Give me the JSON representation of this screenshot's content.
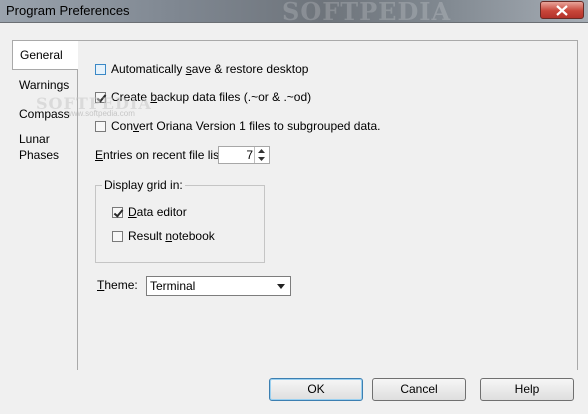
{
  "window": {
    "title": "Program Preferences",
    "watermark_title": "SOFTPEDIA",
    "close_icon": "close-x-icon"
  },
  "tabs": [
    {
      "label": "General",
      "active": true
    },
    {
      "label": "Warnings",
      "active": false
    },
    {
      "label": "Compass",
      "active": false
    },
    {
      "label": "Lunar Phases",
      "active": false
    }
  ],
  "general": {
    "auto_save": {
      "pre": "Automatically ",
      "ul": "s",
      "post": "ave & restore desktop",
      "checked": false
    },
    "backup": {
      "pre": "Create ",
      "ul": "b",
      "post": "ackup data files (.~or & .~od)",
      "checked": true
    },
    "convert": {
      "pre": "Con",
      "ul": "v",
      "post": "ert Oriana Version 1 files to subgrouped data.",
      "checked": false
    },
    "recent": {
      "pre": "",
      "ul": "E",
      "post": "ntries on recent file list",
      "value": "7"
    },
    "display_grid": {
      "legend": "Display grid in:",
      "data_editor": {
        "pre": "",
        "ul": "D",
        "post": "ata editor",
        "checked": true
      },
      "result_notebook": {
        "pre": "Result ",
        "ul": "n",
        "post": "otebook",
        "checked": false
      }
    },
    "theme": {
      "pre": "",
      "ul": "T",
      "post": "heme:",
      "value": "Terminal"
    }
  },
  "watermark": {
    "large": "SOFTPEDIA",
    "small": "www.softpedia.com"
  },
  "buttons": {
    "ok": "OK",
    "cancel": "Cancel",
    "help": "Help"
  },
  "colors": {
    "close_button": "#c8463a",
    "default_button_border": "#3c7fb1"
  }
}
